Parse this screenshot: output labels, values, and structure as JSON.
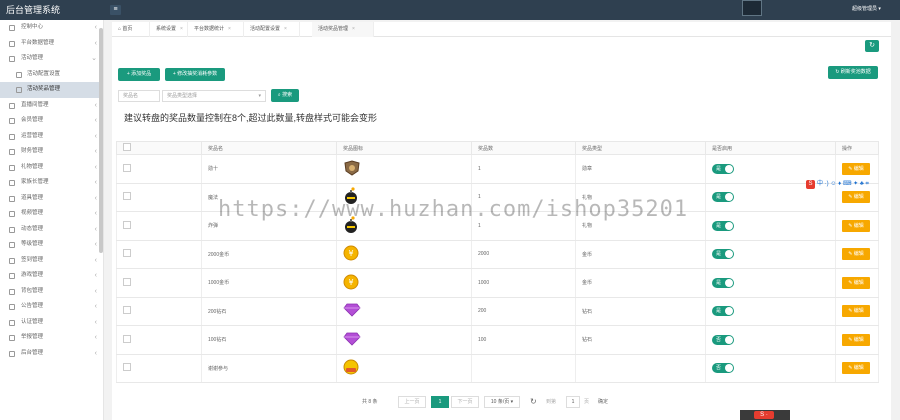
{
  "app": {
    "title": "后台管理系统",
    "menu_toggle_icon": "≡",
    "user_name": "超级管理员 ▾"
  },
  "sidebar": {
    "items": [
      {
        "label": "控制中心",
        "sub": false,
        "active": false,
        "icon": "grid-icon"
      },
      {
        "label": "平台数据管理",
        "sub": false,
        "active": false,
        "icon": "grid-icon"
      },
      {
        "label": "活动管理",
        "sub": false,
        "active": false,
        "icon": "grid-icon",
        "open": true
      },
      {
        "label": "活动配置设置",
        "sub": true,
        "active": false,
        "icon": "doc-icon"
      },
      {
        "label": "活动奖品管理",
        "sub": true,
        "active": true,
        "icon": "doc-icon"
      },
      {
        "label": "直播间管理",
        "sub": false,
        "active": false,
        "icon": "grid-icon"
      },
      {
        "label": "会员管理",
        "sub": false,
        "active": false,
        "icon": "grid-icon"
      },
      {
        "label": "运营管理",
        "sub": false,
        "active": false,
        "icon": "grid-icon"
      },
      {
        "label": "财务管理",
        "sub": false,
        "active": false,
        "icon": "grid-icon"
      },
      {
        "label": "礼物管理",
        "sub": false,
        "active": false,
        "icon": "grid-icon"
      },
      {
        "label": "家族长管理",
        "sub": false,
        "active": false,
        "icon": "grid-icon"
      },
      {
        "label": "道具管理",
        "sub": false,
        "active": false,
        "icon": "grid-icon"
      },
      {
        "label": "视频管理",
        "sub": false,
        "active": false,
        "icon": "grid-icon"
      },
      {
        "label": "动态管理",
        "sub": false,
        "active": false,
        "icon": "grid-icon"
      },
      {
        "label": "等级管理",
        "sub": false,
        "active": false,
        "icon": "grid-icon"
      },
      {
        "label": "签到管理",
        "sub": false,
        "active": false,
        "icon": "grid-icon"
      },
      {
        "label": "游戏管理",
        "sub": false,
        "active": false,
        "icon": "grid-icon"
      },
      {
        "label": "背包管理",
        "sub": false,
        "active": false,
        "icon": "grid-icon"
      },
      {
        "label": "公告管理",
        "sub": false,
        "active": false,
        "icon": "grid-icon"
      },
      {
        "label": "认证管理",
        "sub": false,
        "active": false,
        "icon": "grid-icon"
      },
      {
        "label": "举报管理",
        "sub": false,
        "active": false,
        "icon": "grid-icon"
      },
      {
        "label": "后台管理",
        "sub": false,
        "active": false,
        "icon": "grid-icon"
      }
    ]
  },
  "tabs": [
    {
      "label": "首页",
      "closable": false,
      "icon": "home-icon"
    },
    {
      "label": "系统设置",
      "closable": true
    },
    {
      "label": "平台数据统计",
      "closable": true
    },
    {
      "label": "活动配置设置",
      "closable": true
    },
    {
      "label": "活动奖品管理",
      "closable": true,
      "active": true
    }
  ],
  "toolbar": {
    "add_label": "+ 添加奖品",
    "batch_label": "+ 修改抽奖消耗参数",
    "right_label": "刷新奖池数据",
    "refresh_icon": "↻"
  },
  "filters": {
    "keyword_placeholder": "奖品名",
    "type_placeholder": "奖品类型选择",
    "search_label": "搜索"
  },
  "notice": "建议转盘的奖品数量控制在8个,超过此数量,转盘样式可能会变形",
  "table": {
    "headers": [
      "",
      "奖品名",
      "奖品图标",
      "奖品数",
      "奖品类型",
      "是否启用",
      "操作"
    ],
    "rows": [
      {
        "name": "勋十",
        "icon": "badge-icon",
        "count": "1",
        "type": "勋章",
        "enabled": "是",
        "action": "✎ 编辑"
      },
      {
        "name": "魔法",
        "icon": "bomb-icon",
        "count": "1",
        "type": "礼物",
        "enabled": "是",
        "action": "✎ 编辑"
      },
      {
        "name": "炸弹",
        "icon": "bomb-icon",
        "count": "1",
        "type": "礼物",
        "enabled": "是",
        "action": "✎ 编辑"
      },
      {
        "name": "2000金币",
        "icon": "coin-icon",
        "count": "2000",
        "type": "金币",
        "enabled": "是",
        "action": "✎ 编辑"
      },
      {
        "name": "1000金币",
        "icon": "coin-icon",
        "count": "1000",
        "type": "金币",
        "enabled": "是",
        "action": "✎ 编辑"
      },
      {
        "name": "200钻石",
        "icon": "diamond-icon",
        "count": "200",
        "type": "钻石",
        "enabled": "是",
        "action": "✎ 编辑"
      },
      {
        "name": "100钻石",
        "icon": "diamond-icon",
        "count": "100",
        "type": "钻石",
        "enabled": "否",
        "action": "✎ 编辑"
      },
      {
        "name": "谢谢参与",
        "icon": "thanks-icon",
        "count": "",
        "type": "",
        "enabled": "否",
        "action": "✎ 编辑"
      }
    ]
  },
  "pagination": {
    "total": "共 8 条",
    "prev": "上一页",
    "current": "1",
    "next": "下一页",
    "per_page": "10 条/页 ▾",
    "goto_prefix": "到第",
    "goto_value": "1",
    "goto_suffix": "页",
    "confirm": "确定"
  },
  "overlay": {
    "watermark": "https://www.huzhan.com/ishop35201",
    "ime_label": "S",
    "ime_text": "中 ·) ☺ ♦ ⌨ ✦ ♣ ⌗",
    "taskbar_label": "S ·"
  },
  "colors": {
    "primary": "#1a9a7e",
    "edit": "#f7a800",
    "topbar": "#2f4050"
  }
}
